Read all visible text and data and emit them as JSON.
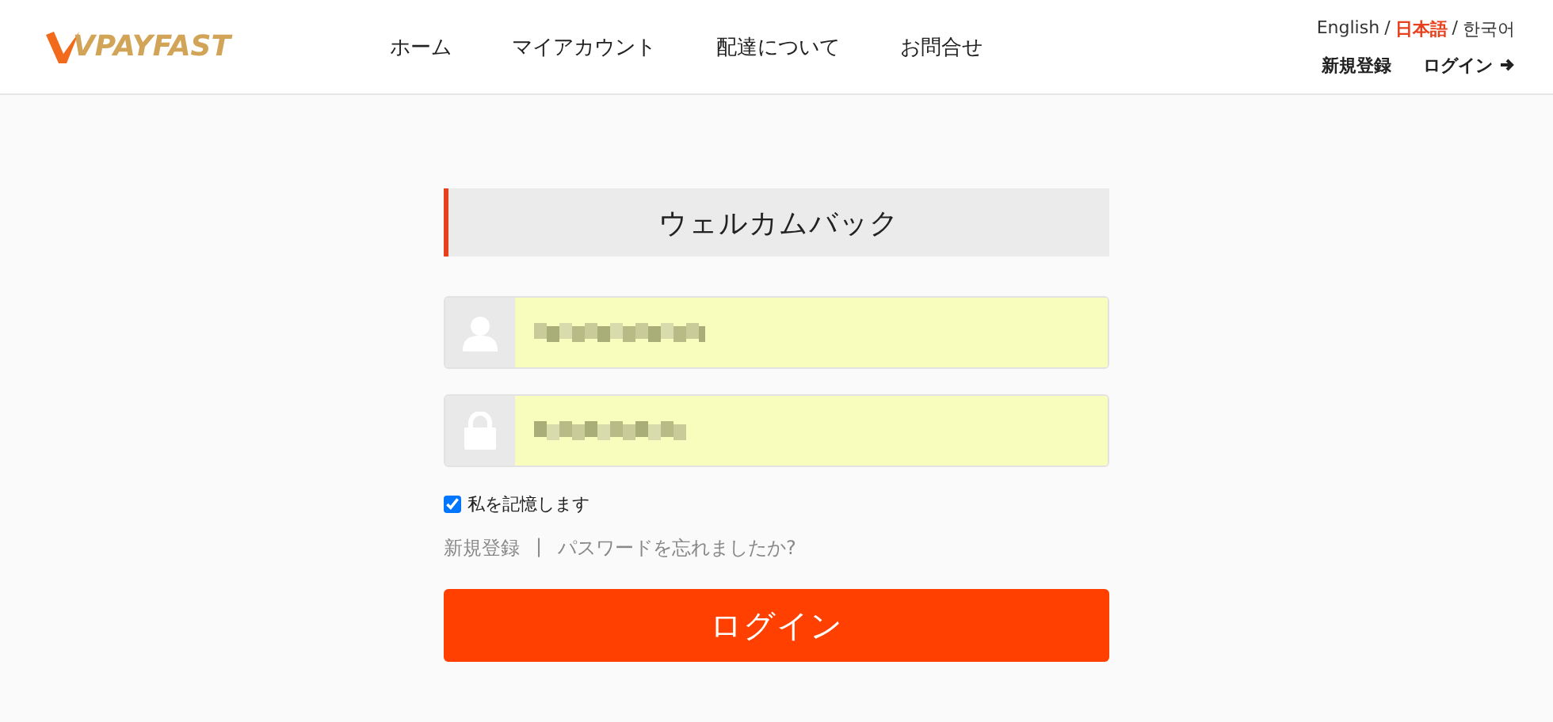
{
  "logo": {
    "text": "VPAYFAST"
  },
  "nav": [
    {
      "label": "ホーム"
    },
    {
      "label": "マイアカウント"
    },
    {
      "label": "配達について"
    },
    {
      "label": "お問合せ"
    }
  ],
  "language_separators": [
    "/",
    "/"
  ],
  "languages": [
    {
      "label": "English",
      "selected": false
    },
    {
      "label": "日本語",
      "selected": true
    },
    {
      "label": "한국어",
      "selected": false
    }
  ],
  "account_links": [
    {
      "label": "新規登録",
      "kind": "plain"
    },
    {
      "label": "ログイン",
      "kind": "arrow"
    }
  ],
  "form": {
    "title": "ウェルカムバック",
    "fields": [
      {
        "kind": "user"
      },
      {
        "kind": "password"
      }
    ],
    "remember": {
      "label": "私を記憶します",
      "checked": true
    },
    "links": [
      {
        "label": "新規登録"
      },
      {
        "label": "パスワードを忘れましたか?"
      }
    ],
    "separator": "|",
    "submit": "ログイン"
  }
}
